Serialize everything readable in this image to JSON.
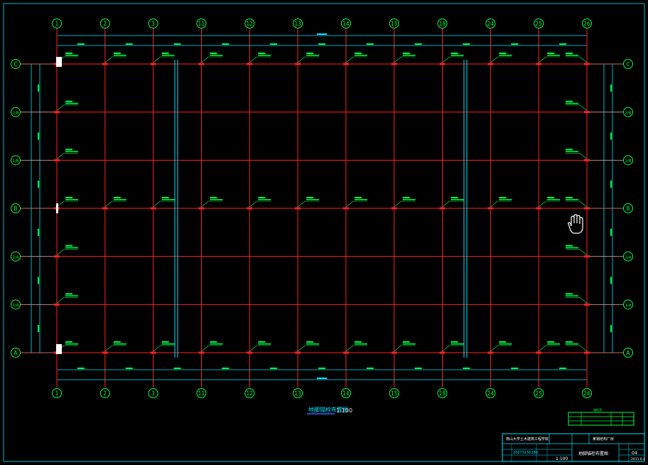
{
  "drawing": {
    "title": "地脚锚栓布置图",
    "scale": "1:100",
    "background": "#000000",
    "colors": {
      "axis": "#ff2020",
      "frame": "#00e5ff",
      "bubble": "#00ff44",
      "label": "#00ff44",
      "cursor": "#ffffff"
    }
  },
  "grid": {
    "columns": [
      "1",
      "2",
      "3",
      "11",
      "12",
      "13",
      "14",
      "15",
      "18",
      "24",
      "25",
      "26"
    ],
    "rows": [
      "C",
      "2/B",
      "1/B",
      "B",
      "2/A",
      "1/A",
      "A"
    ]
  },
  "title_block": {
    "school": "燕山大学土木建筑工程学院",
    "project": "某钢结构厂房",
    "drawing_name": "地脚锚栓布置图",
    "student_id": "20073150180",
    "scale": "1:100",
    "sheet_no": "04",
    "date": "2011.6.4"
  },
  "legend_table": {
    "header": "锚栓表"
  }
}
